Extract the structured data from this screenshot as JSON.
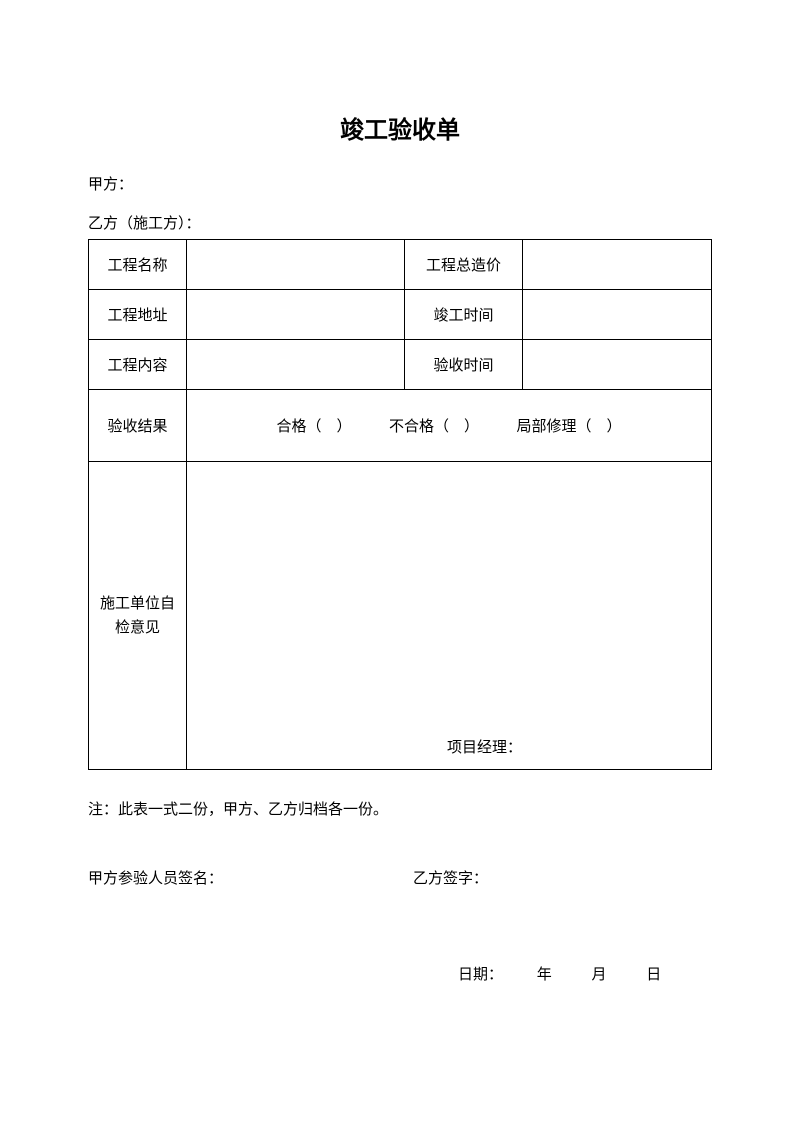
{
  "title": "竣工验收单",
  "partyA": "甲方：",
  "partyB": "乙方（施工方）：",
  "labels": {
    "projectName": "工程名称",
    "totalCost": "工程总造价",
    "projectAddress": "工程地址",
    "completionTime": "竣工时间",
    "projectContent": "工程内容",
    "acceptanceTime": "验收时间",
    "acceptanceResult": "验收结果",
    "opinion1": "施工单位自",
    "opinion2": "检意见",
    "projectManager": "项目经理："
  },
  "resultOptions": "合格（　）　　　不合格（　）　　　局部修理（　）",
  "note": "注：此表一式二份，甲方、乙方归档各一份。",
  "signA": "甲方参验人员签名：",
  "signB": "乙方签字：",
  "date": {
    "label": "日期：",
    "year": "年",
    "month": "月",
    "day": "日"
  }
}
